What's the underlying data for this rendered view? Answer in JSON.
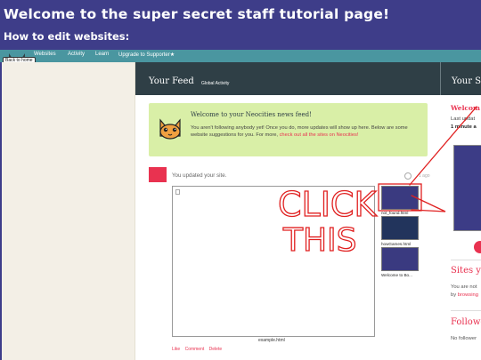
{
  "tutorial": {
    "title": "Welcome to the super secret staff tutorial page!",
    "subtitle": "How to edit websites:"
  },
  "nav": {
    "back_home": "Back to home",
    "links": [
      "Websites",
      "Activity",
      "Learn",
      "Upgrade to Supporter★"
    ]
  },
  "feed": {
    "title": "Your Feed",
    "global_activity": "Global Activity",
    "welcome": {
      "title": "Welcome to your Neocities news feed!",
      "body": "You aren't following anybody yet! Once you do, more updates will show up here. Below are some website suggestions for you. For more, ",
      "link": "check out all the sites on Neocities",
      "end": "!"
    },
    "update": {
      "text": "You updated your site.",
      "time": "1 ago",
      "main_file": "example.html",
      "files": [
        "not_found.html",
        "howGames.html",
        "Welcome to Bo..."
      ],
      "actions": [
        "Like",
        "Comment",
        "Delete"
      ]
    }
  },
  "right": {
    "title": "Your S",
    "welcome": "Welcom",
    "last_updated": "Last updat",
    "minute": "1 minute a",
    "sites_title": "Sites yo",
    "not_following": "You are not",
    "by_prefix": "by ",
    "by_link": "browsing",
    "followers_title": "Followe",
    "no_followers": "No follower"
  },
  "annotation": {
    "line1": "CLICK",
    "line2": "THIS",
    "color": "#e02020"
  },
  "colors": {
    "banner": "#3e3d89",
    "nav": "#4a96a0",
    "header": "#2f3f46",
    "accent": "#e93250",
    "welcome_bg": "#d9efa7"
  }
}
